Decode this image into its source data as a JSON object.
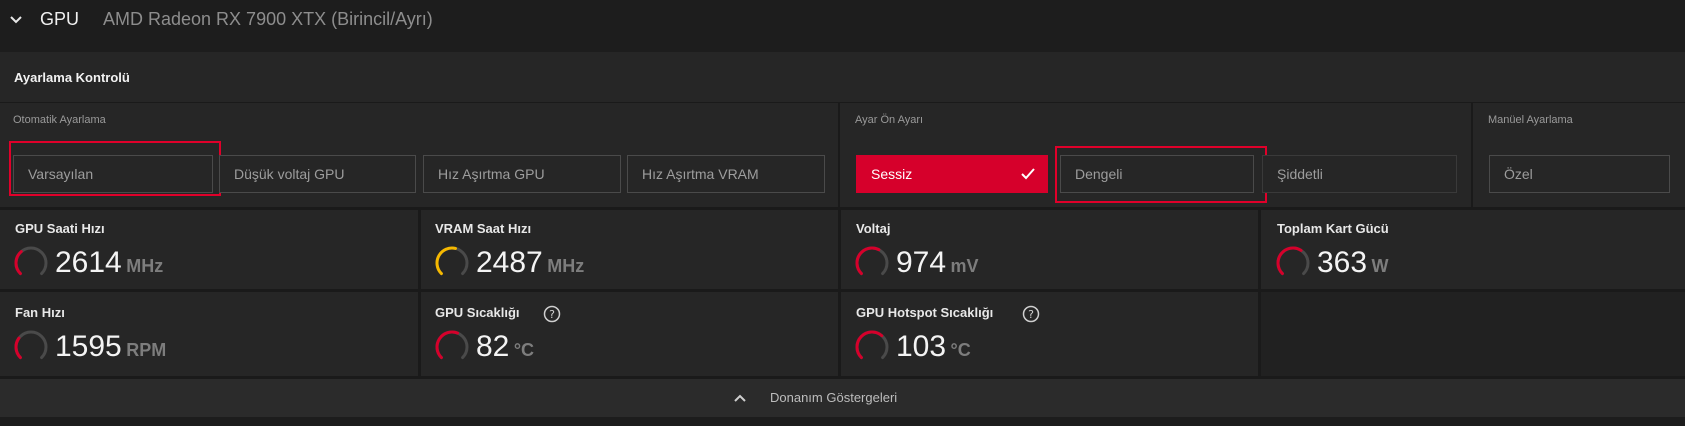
{
  "header": {
    "section": "GPU",
    "device": "AMD Radeon RX 7900 XTX (Birincil/Ayrı)"
  },
  "tuning": {
    "title": "Ayarlama Kontrolü",
    "auto": {
      "label": "Otomatik Ayarlama",
      "options": [
        "Varsayılan",
        "Düşük voltaj GPU",
        "Hız Aşırtma GPU",
        "Hız Aşırtma VRAM"
      ]
    },
    "preset": {
      "label": "Ayar Ön Ayarı",
      "options": [
        "Sessiz",
        "Dengeli",
        "Şiddetli"
      ],
      "selected": "Sessiz"
    },
    "manual": {
      "label": "Manüel Ayarlama",
      "option": "Özel"
    }
  },
  "metrics": [
    {
      "title": "GPU Saati Hızı",
      "value": "2614",
      "unit": "MHz",
      "gauge_color": "#d6002b",
      "level": 0.35
    },
    {
      "title": "VRAM Saat Hızı",
      "value": "2487",
      "unit": "MHz",
      "gauge_color": "#f5b800",
      "level": 0.55
    },
    {
      "title": "Voltaj",
      "value": "974",
      "unit": "mV",
      "gauge_color": "#d6002b",
      "level": 0.6
    },
    {
      "title": "Toplam Kart Gücü",
      "value": "363",
      "unit": "W",
      "gauge_color": "#d6002b",
      "level": 0.62
    },
    {
      "title": "Fan Hızı",
      "value": "1595",
      "unit": "RPM",
      "gauge_color": "#d6002b",
      "level": 0.3
    },
    {
      "title": "GPU Sıcaklığı",
      "value": "82",
      "unit": "°C",
      "gauge_color": "#d6002b",
      "level": 0.58
    },
    {
      "title": "GPU Hotspot Sıcaklığı",
      "value": "103",
      "unit": "°C",
      "gauge_color": "#d6002b",
      "level": 0.65
    }
  ],
  "footer": {
    "label": "Donanım Göstergeleri"
  },
  "colors": {
    "accent": "#d6002b",
    "highlight_box": "#e0002a"
  }
}
